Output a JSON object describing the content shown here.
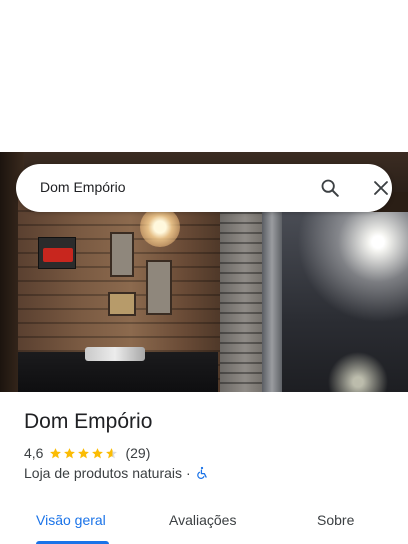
{
  "search": {
    "query": "Dom Empório",
    "search_icon": "search-icon",
    "close_icon": "close-icon"
  },
  "place": {
    "name": "Dom Empório",
    "rating": "4,6",
    "stars_value": 4.6,
    "stars_max": 5,
    "review_count": "(29)",
    "category": "Loja de produtos naturais",
    "separator": "·",
    "accessibility_icon": "wheelchair-icon"
  },
  "tabs": [
    {
      "label": "Visão geral",
      "active": true
    },
    {
      "label": "Avaliações",
      "active": false
    },
    {
      "label": "Sobre",
      "active": false
    }
  ],
  "colors": {
    "accent": "#1a73e8",
    "star": "#fbbc04",
    "text": "#202124"
  }
}
